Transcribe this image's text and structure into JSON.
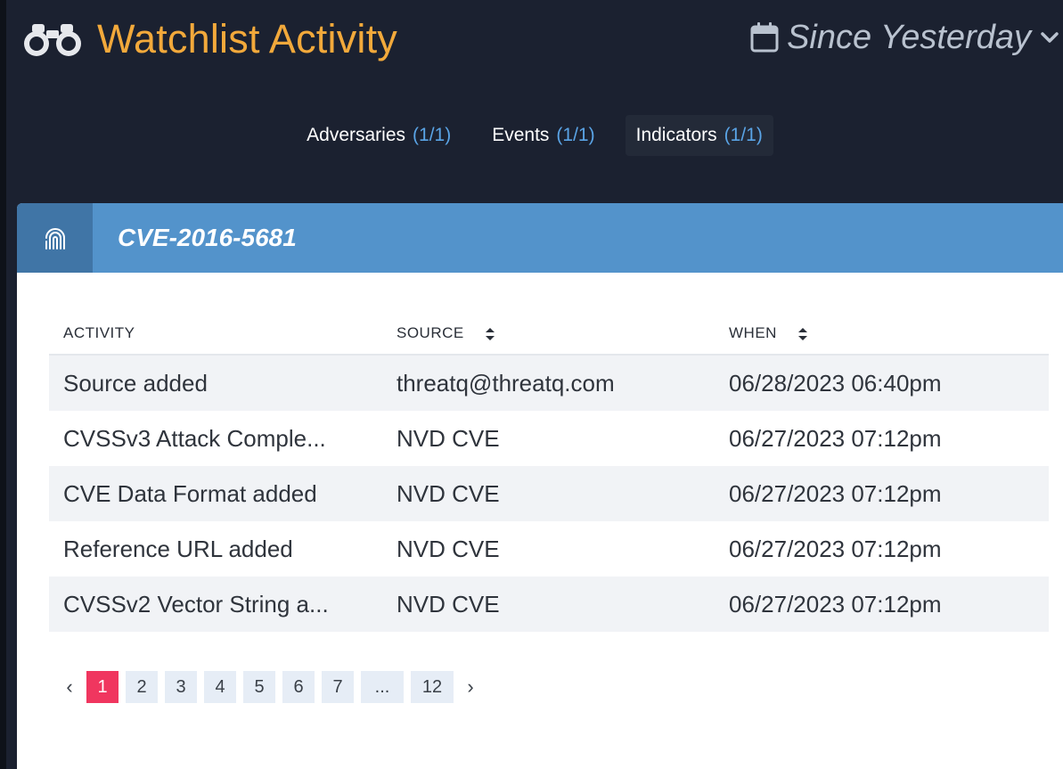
{
  "header": {
    "title": "Watchlist Activity",
    "title_icon": "binoculars-icon",
    "range_label": "Since Yesterday",
    "range_icon": "calendar-icon",
    "colors": {
      "title": "#f2a93b",
      "background": "#1b2130"
    }
  },
  "tabs": [
    {
      "label": "Adversaries",
      "count": "(1/1)",
      "active": false
    },
    {
      "label": "Events",
      "count": "(1/1)",
      "active": false
    },
    {
      "label": "Indicators",
      "count": "(1/1)",
      "active": true
    }
  ],
  "panel": {
    "title": "CVE-2016-5681",
    "icon": "fingerprint-icon",
    "header_color": "#5393cb",
    "columns": [
      "ACTIVITY",
      "SOURCE",
      "WHEN"
    ],
    "rows": [
      {
        "activity": "Source added",
        "source": "threatq@threatq.com",
        "when": "06/28/2023 06:40pm"
      },
      {
        "activity": "CVSSv3 Attack Comple...",
        "source": "NVD CVE",
        "when": "06/27/2023 07:12pm"
      },
      {
        "activity": "CVE Data Format added",
        "source": "NVD CVE",
        "when": "06/27/2023 07:12pm"
      },
      {
        "activity": "Reference URL added",
        "source": "NVD CVE",
        "when": "06/27/2023 07:12pm"
      },
      {
        "activity": "CVSSv2 Vector String a...",
        "source": "NVD CVE",
        "when": "06/27/2023 07:12pm"
      }
    ]
  },
  "pagination": {
    "prev": "‹",
    "next": "›",
    "pages": [
      "1",
      "2",
      "3",
      "4",
      "5",
      "6",
      "7",
      "...",
      "12"
    ],
    "current": "1",
    "current_color": "#f0365f"
  }
}
